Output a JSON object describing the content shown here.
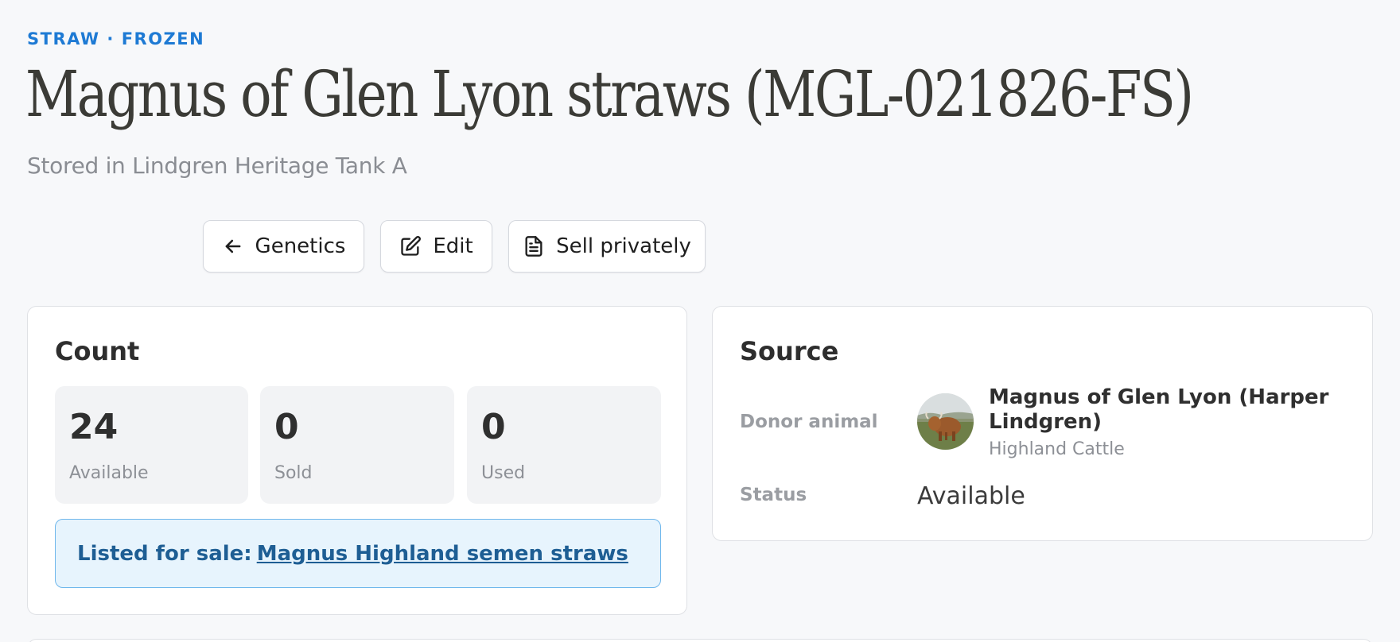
{
  "header": {
    "eyebrow": "STRAW · FROZEN",
    "title": "Magnus of Glen Lyon straws (MGL-021826-FS)",
    "subtitle": "Stored in Lindgren Heritage Tank A"
  },
  "actions": {
    "back_label": "Genetics",
    "edit_label": "Edit",
    "sell_label": "Sell privately"
  },
  "count_card": {
    "title": "Count",
    "stats": [
      {
        "value": "24",
        "label": "Available"
      },
      {
        "value": "0",
        "label": "Sold"
      },
      {
        "value": "0",
        "label": "Used"
      }
    ],
    "listing_prefix": "Listed for sale:",
    "listing_link": "Magnus Highland semen straws"
  },
  "source_card": {
    "title": "Source",
    "donor_label": "Donor animal",
    "donor_name": "Magnus of Glen Lyon (Harper Lindgren)",
    "donor_breed": "Highland Cattle",
    "status_label": "Status",
    "status_value": "Available"
  },
  "icons": {
    "back": "arrow-left-icon",
    "edit": "pencil-square-icon",
    "sell": "document-icon"
  },
  "colors": {
    "accent": "#1e7ad4",
    "listing_bg": "#e7f4fd",
    "listing_border": "#6fb7ec",
    "listing_text": "#1e5e94"
  }
}
